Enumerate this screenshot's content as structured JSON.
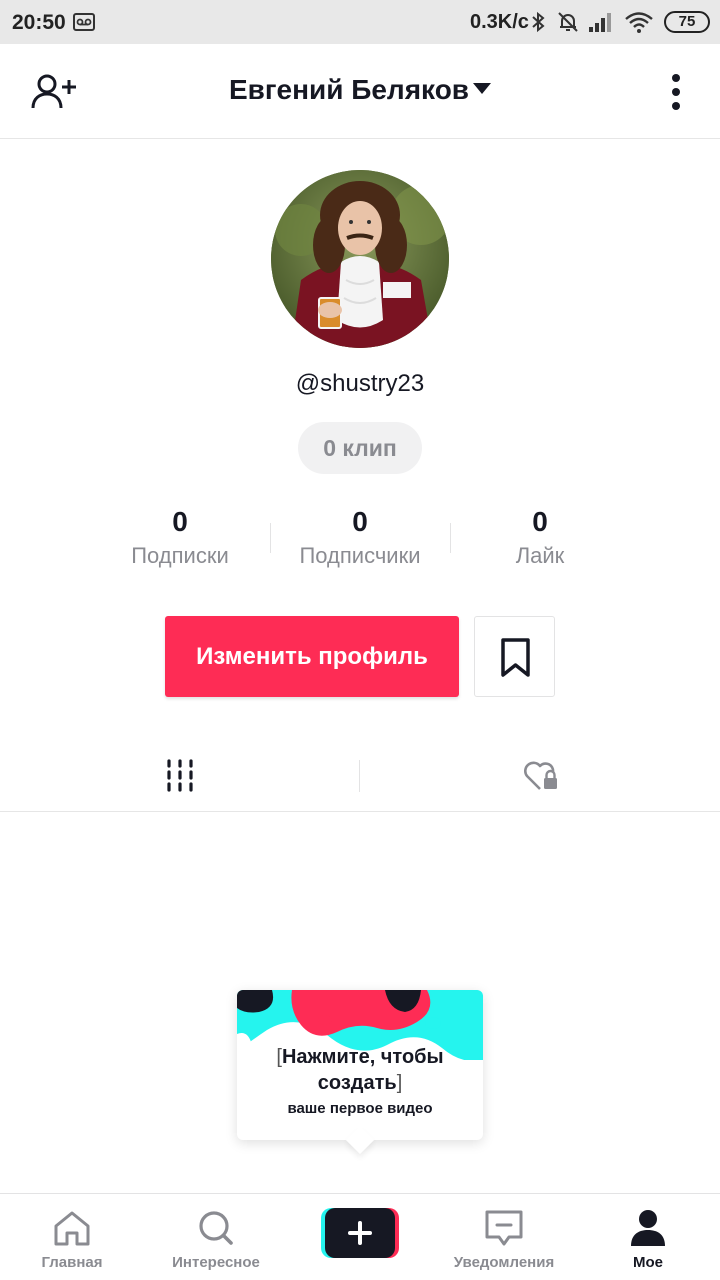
{
  "status_bar": {
    "time": "20:50",
    "speed": "0.3K/c",
    "battery": "75"
  },
  "header": {
    "title": "Евгений Беляков",
    "add_friend_icon": "add-user-icon",
    "more_icon": "more-vertical-icon"
  },
  "profile": {
    "username": "@shustry23",
    "clip_count": "0 клип",
    "stats": [
      {
        "value": "0",
        "label": "Подписки"
      },
      {
        "value": "0",
        "label": "Подписчики"
      },
      {
        "value": "0",
        "label": "Лайк"
      }
    ],
    "edit_button": "Изменить профиль",
    "bookmark_icon": "bookmark-icon"
  },
  "tabs": [
    {
      "icon": "grid-icon",
      "active": true
    },
    {
      "icon": "heart-lock-icon",
      "active": false
    }
  ],
  "tooltip": {
    "line1_open": "[",
    "line1": "Нажмите, чтобы",
    "line2": "создать",
    "line2_close": "]",
    "subtitle": "ваше первое видео"
  },
  "bottom_nav": [
    {
      "label": "Главная",
      "icon": "home-icon",
      "active": false
    },
    {
      "label": "Интересное",
      "icon": "search-icon",
      "active": false
    },
    {
      "label": "",
      "icon": "plus-icon",
      "active": false
    },
    {
      "label": "Уведомления",
      "icon": "message-icon",
      "active": false
    },
    {
      "label": "Мое",
      "icon": "profile-icon",
      "active": true
    }
  ],
  "colors": {
    "accent": "#fe2c55",
    "cyan": "#25f4ee",
    "text": "#161823",
    "muted": "#8a8b91"
  }
}
